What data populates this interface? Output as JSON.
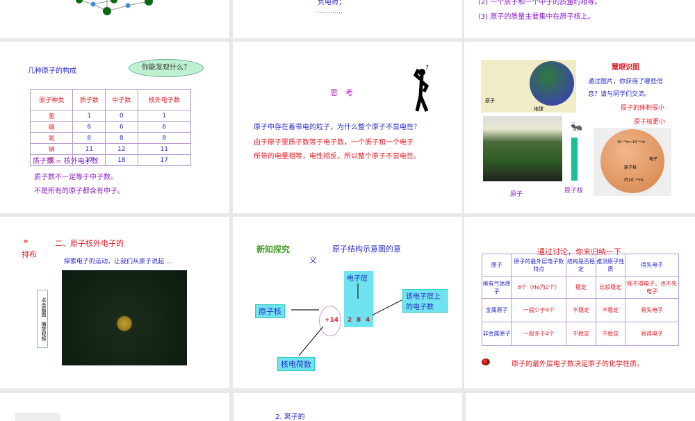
{
  "slide1": {},
  "slide2": {
    "line_cut": "负电荷；",
    "dots": "…………"
  },
  "slide3": {
    "line_cut": "(2) 一个质子和一个中子的质量约相等。",
    "line3": "(3) 原子的质量主要集中在原子核上。"
  },
  "slide4": {
    "title": "几种原子的构成",
    "bubble": "你能发现什么？",
    "headers": [
      "原子种类",
      "质子数",
      "中子数",
      "核外电子数"
    ],
    "rows": [
      [
        "氢",
        "1",
        "0",
        "1"
      ],
      [
        "碳",
        "6",
        "6",
        "6"
      ],
      [
        "氧",
        "8",
        "8",
        "8"
      ],
      [
        "钠",
        "11",
        "12",
        "11"
      ],
      [
        "氯",
        "17",
        "18",
        "17"
      ]
    ],
    "notes": [
      "质子数 = 核外电子数",
      "质子数不一定等于中子数。",
      "不是所有的原子都含有中子。"
    ]
  },
  "slide5": {
    "title": "思　考",
    "question": "原子中存在着带电的粒子，为什么整个原子不显电性？",
    "answer1": "由于原子里质子数等于电子数，一个质子和一个电子",
    "answer2": "所带的电量相等，电性相反，所以整个原子不显电性。"
  },
  "slide6": {
    "title": "慧眼识图",
    "text1": "通过图片，你获得了哪些信",
    "text2": "息？请与同学们交流。",
    "point1": "原子的体积很小",
    "point2": "原子核更小",
    "label_atom": "原子",
    "label_earth": "地球",
    "label_atom2": "原子",
    "label_nucleus": "原子核",
    "fig_size1": "10⁻¹⁵m~10⁻¹⁴m",
    "fig_nucleus": "原子核",
    "fig_electron": "电子",
    "fig_size2": "约10⁻¹⁰m"
  },
  "slide7": {
    "title1": "二、原子核外电子的",
    "title2": "排布",
    "subtitle": "探索电子的运动，让我们从原子说起 ...",
    "button": "点击画面　播放视频"
  },
  "slide8": {
    "logo": "新知探究",
    "title": "原子结构示意图的意",
    "title2": "义",
    "electron_shell": "电子层",
    "nucleus": "原子核",
    "shell_count": "该电子层上的电子数",
    "charge": "核电荷数",
    "plus": "+14",
    "n1": "2",
    "n2": "8",
    "n3": "4"
  },
  "slide9": {
    "title": "通过讨论，你来归纳一下",
    "headers": [
      "原子",
      "原子的最外层电子数特点",
      "结构是否稳定",
      "推测原子性质",
      "得失电子"
    ],
    "rows": [
      [
        "稀有气体原子",
        "8个（He为2个）",
        "稳定",
        "比较稳定",
        "既不得电子，也不失电子"
      ],
      [
        "金属原子",
        "一般少于4个",
        "不稳定",
        "不稳定",
        "易失电子"
      ],
      [
        "非金属原子",
        "一般多于4个",
        "不稳定",
        "不稳定",
        "易得电子"
      ]
    ],
    "conclusion": "原子的最外层电子数决定原子的化学性质。"
  },
  "slide11": {
    "title": "2. 离子的"
  }
}
